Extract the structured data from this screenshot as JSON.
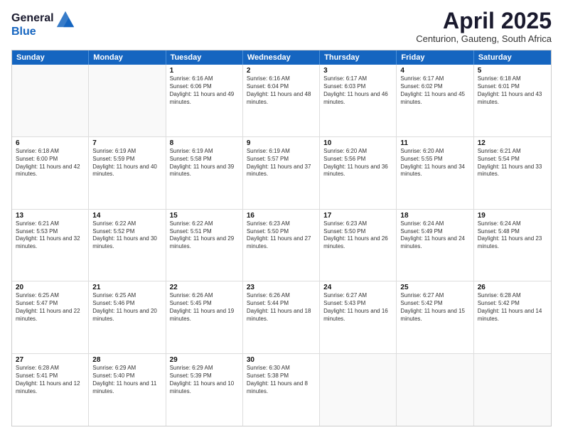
{
  "header": {
    "logo_line1": "General",
    "logo_line2": "Blue",
    "title": "April 2025",
    "subtitle": "Centurion, Gauteng, South Africa"
  },
  "days": [
    "Sunday",
    "Monday",
    "Tuesday",
    "Wednesday",
    "Thursday",
    "Friday",
    "Saturday"
  ],
  "weeks": [
    [
      {
        "day": "",
        "text": ""
      },
      {
        "day": "",
        "text": ""
      },
      {
        "day": "1",
        "text": "Sunrise: 6:16 AM\nSunset: 6:06 PM\nDaylight: 11 hours and 49 minutes."
      },
      {
        "day": "2",
        "text": "Sunrise: 6:16 AM\nSunset: 6:04 PM\nDaylight: 11 hours and 48 minutes."
      },
      {
        "day": "3",
        "text": "Sunrise: 6:17 AM\nSunset: 6:03 PM\nDaylight: 11 hours and 46 minutes."
      },
      {
        "day": "4",
        "text": "Sunrise: 6:17 AM\nSunset: 6:02 PM\nDaylight: 11 hours and 45 minutes."
      },
      {
        "day": "5",
        "text": "Sunrise: 6:18 AM\nSunset: 6:01 PM\nDaylight: 11 hours and 43 minutes."
      }
    ],
    [
      {
        "day": "6",
        "text": "Sunrise: 6:18 AM\nSunset: 6:00 PM\nDaylight: 11 hours and 42 minutes."
      },
      {
        "day": "7",
        "text": "Sunrise: 6:19 AM\nSunset: 5:59 PM\nDaylight: 11 hours and 40 minutes."
      },
      {
        "day": "8",
        "text": "Sunrise: 6:19 AM\nSunset: 5:58 PM\nDaylight: 11 hours and 39 minutes."
      },
      {
        "day": "9",
        "text": "Sunrise: 6:19 AM\nSunset: 5:57 PM\nDaylight: 11 hours and 37 minutes."
      },
      {
        "day": "10",
        "text": "Sunrise: 6:20 AM\nSunset: 5:56 PM\nDaylight: 11 hours and 36 minutes."
      },
      {
        "day": "11",
        "text": "Sunrise: 6:20 AM\nSunset: 5:55 PM\nDaylight: 11 hours and 34 minutes."
      },
      {
        "day": "12",
        "text": "Sunrise: 6:21 AM\nSunset: 5:54 PM\nDaylight: 11 hours and 33 minutes."
      }
    ],
    [
      {
        "day": "13",
        "text": "Sunrise: 6:21 AM\nSunset: 5:53 PM\nDaylight: 11 hours and 32 minutes."
      },
      {
        "day": "14",
        "text": "Sunrise: 6:22 AM\nSunset: 5:52 PM\nDaylight: 11 hours and 30 minutes."
      },
      {
        "day": "15",
        "text": "Sunrise: 6:22 AM\nSunset: 5:51 PM\nDaylight: 11 hours and 29 minutes."
      },
      {
        "day": "16",
        "text": "Sunrise: 6:23 AM\nSunset: 5:50 PM\nDaylight: 11 hours and 27 minutes."
      },
      {
        "day": "17",
        "text": "Sunrise: 6:23 AM\nSunset: 5:50 PM\nDaylight: 11 hours and 26 minutes."
      },
      {
        "day": "18",
        "text": "Sunrise: 6:24 AM\nSunset: 5:49 PM\nDaylight: 11 hours and 24 minutes."
      },
      {
        "day": "19",
        "text": "Sunrise: 6:24 AM\nSunset: 5:48 PM\nDaylight: 11 hours and 23 minutes."
      }
    ],
    [
      {
        "day": "20",
        "text": "Sunrise: 6:25 AM\nSunset: 5:47 PM\nDaylight: 11 hours and 22 minutes."
      },
      {
        "day": "21",
        "text": "Sunrise: 6:25 AM\nSunset: 5:46 PM\nDaylight: 11 hours and 20 minutes."
      },
      {
        "day": "22",
        "text": "Sunrise: 6:26 AM\nSunset: 5:45 PM\nDaylight: 11 hours and 19 minutes."
      },
      {
        "day": "23",
        "text": "Sunrise: 6:26 AM\nSunset: 5:44 PM\nDaylight: 11 hours and 18 minutes."
      },
      {
        "day": "24",
        "text": "Sunrise: 6:27 AM\nSunset: 5:43 PM\nDaylight: 11 hours and 16 minutes."
      },
      {
        "day": "25",
        "text": "Sunrise: 6:27 AM\nSunset: 5:42 PM\nDaylight: 11 hours and 15 minutes."
      },
      {
        "day": "26",
        "text": "Sunrise: 6:28 AM\nSunset: 5:42 PM\nDaylight: 11 hours and 14 minutes."
      }
    ],
    [
      {
        "day": "27",
        "text": "Sunrise: 6:28 AM\nSunset: 5:41 PM\nDaylight: 11 hours and 12 minutes."
      },
      {
        "day": "28",
        "text": "Sunrise: 6:29 AM\nSunset: 5:40 PM\nDaylight: 11 hours and 11 minutes."
      },
      {
        "day": "29",
        "text": "Sunrise: 6:29 AM\nSunset: 5:39 PM\nDaylight: 11 hours and 10 minutes."
      },
      {
        "day": "30",
        "text": "Sunrise: 6:30 AM\nSunset: 5:38 PM\nDaylight: 11 hours and 8 minutes."
      },
      {
        "day": "",
        "text": ""
      },
      {
        "day": "",
        "text": ""
      },
      {
        "day": "",
        "text": ""
      }
    ]
  ]
}
